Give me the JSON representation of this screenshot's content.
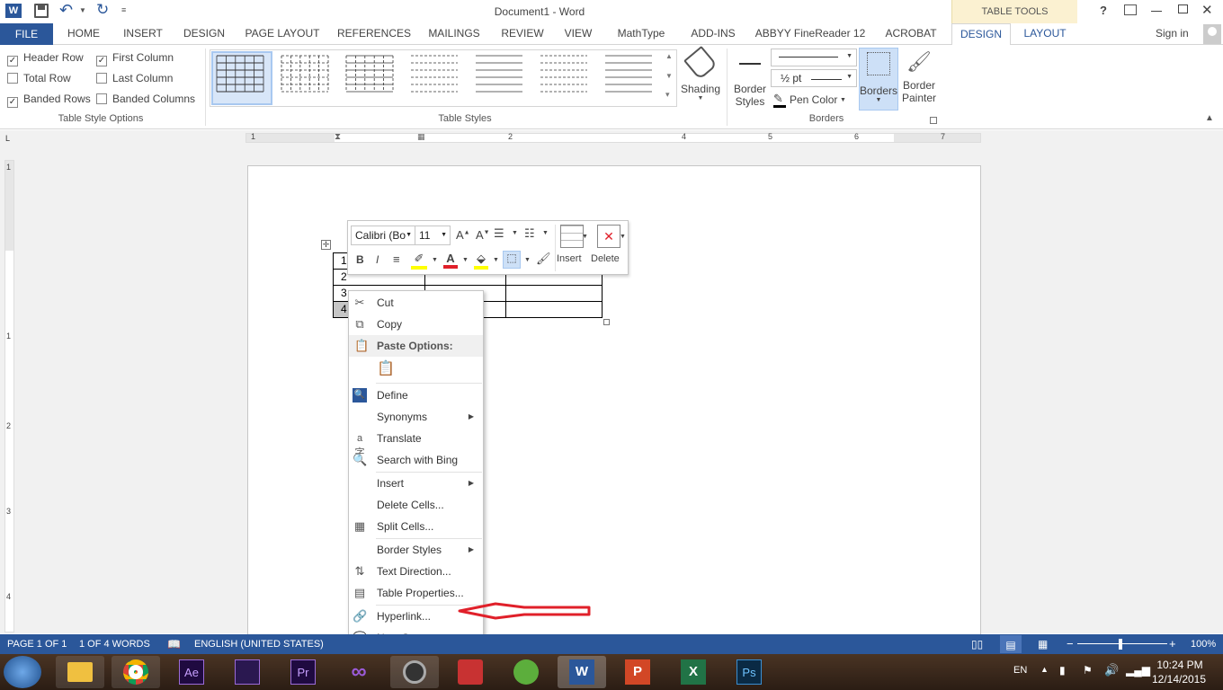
{
  "window": {
    "title": "Document1 - Word",
    "contextual_group": "TABLE TOOLS",
    "help": "?",
    "sign_in": "Sign in"
  },
  "tabs": [
    "FILE",
    "HOME",
    "INSERT",
    "DESIGN",
    "PAGE LAYOUT",
    "REFERENCES",
    "MAILINGS",
    "REVIEW",
    "VIEW",
    "MathType",
    "ADD-INS",
    "ABBYY FineReader 12",
    "ACROBAT",
    "DESIGN",
    "LAYOUT"
  ],
  "table_style_options": {
    "header_row": "Header Row",
    "first_column": "First Column",
    "total_row": "Total Row",
    "last_column": "Last Column",
    "banded_rows": "Banded Rows",
    "banded_columns": "Banded Columns",
    "group_label": "Table Style Options"
  },
  "table_styles": {
    "group_label": "Table Styles"
  },
  "shading": {
    "label": "Shading"
  },
  "borders_group": {
    "border_styles": "Border\nStyles",
    "border_styles_1": "Border",
    "border_styles_2": "Styles",
    "pen_weight": "½ pt",
    "pen_color": "Pen Color",
    "borders": "Borders",
    "border_painter_1": "Border",
    "border_painter_2": "Painter",
    "group_label": "Borders"
  },
  "ruler": {
    "numbers": [
      "1",
      "1",
      "2",
      "3",
      "4",
      "5",
      "6",
      "7"
    ],
    "vnumbers": [
      "1",
      "1",
      "2",
      "3",
      "4"
    ]
  },
  "document": {
    "rows": [
      "1",
      "2",
      "3",
      "4"
    ]
  },
  "mini_toolbar": {
    "font": "Calibri (Bo",
    "size": "11",
    "bold": "B",
    "italic": "I",
    "insert": "Insert",
    "delete": "Delete"
  },
  "context_menu": {
    "cut": "Cut",
    "copy": "Copy",
    "paste_options": "Paste Options:",
    "define": "Define",
    "synonyms": "Synonyms",
    "translate": "Translate",
    "search_bing": "Search with Bing",
    "insert": "Insert",
    "delete_cells": "Delete Cells...",
    "split_cells": "Split Cells...",
    "border_styles": "Border Styles",
    "text_direction": "Text Direction...",
    "table_properties": "Table Properties...",
    "hyperlink": "Hyperlink...",
    "new_comment": "New Comment"
  },
  "status": {
    "page": "PAGE 1 OF 1",
    "words": "1 OF 4 WORDS",
    "language": "ENGLISH (UNITED STATES)",
    "zoom": "100%"
  },
  "taskbar": {
    "lang": "EN",
    "time": "10:24 PM",
    "date": "12/14/2015"
  },
  "colors": {
    "accent": "#2b579a",
    "annotation": "#e0202a",
    "contextual": "#fbf1d1"
  }
}
